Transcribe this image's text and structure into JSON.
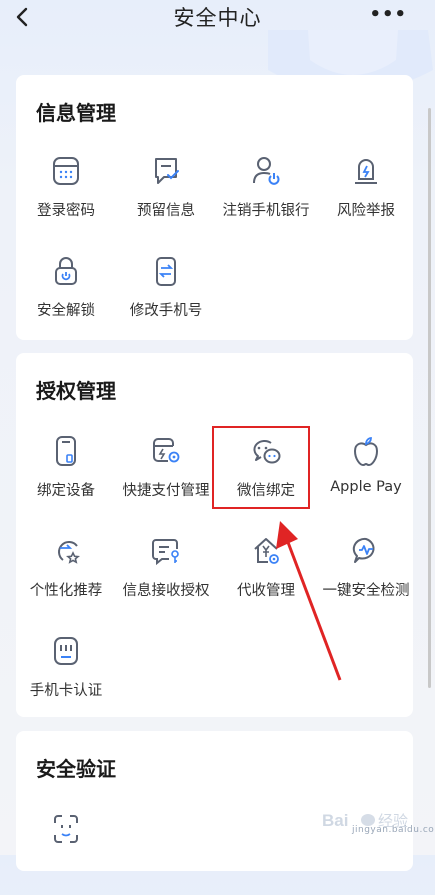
{
  "header": {
    "title": "安全中心",
    "more": "•••"
  },
  "sections": [
    {
      "title": "信息管理",
      "items": [
        "登录密码",
        "预留信息",
        "注销手机银行",
        "风险举报",
        "安全解锁",
        "修改手机号"
      ]
    },
    {
      "title": "授权管理",
      "items": [
        "绑定设备",
        "快捷支付管理",
        "微信绑定",
        "Apple Pay",
        "个性化推荐",
        "信息接收授权",
        "代收管理",
        "一键安全检测",
        "手机卡认证"
      ]
    },
    {
      "title": "安全验证",
      "items": []
    }
  ],
  "watermark": {
    "text": "jingyan.baidu.com"
  },
  "colors": {
    "icon": "#5a6272",
    "accent": "#3b82f6",
    "highlight": "#e02424"
  }
}
